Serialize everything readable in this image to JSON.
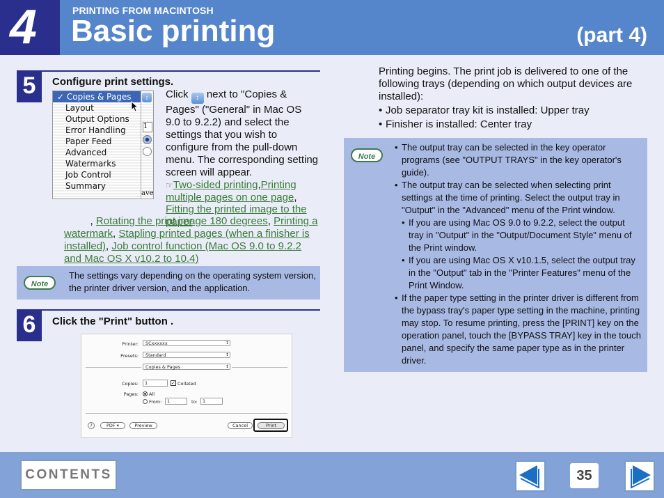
{
  "header": {
    "chapter_number": "4",
    "section_label": "PRINTING FROM MACINTOSH",
    "title": "Basic printing",
    "part": "(part 4)"
  },
  "step5": {
    "number": "5",
    "title": "Configure print settings.",
    "menu_items": [
      "✓ Copies & Pages",
      "Layout",
      "Output Options",
      "Error Handling",
      "Paper Feed",
      "Advanced",
      "Watermarks",
      "Job Control",
      "Summary"
    ],
    "menu_side_fragment": "ave",
    "menu_side_input": "1",
    "text_before_icon": "Click",
    "text_after_icon": " next to \"Copies & Pages\" (\"General\" in Mac OS 9.0 to 9.2.2) and select the settings that you wish to configure from the pull-down menu. The corresponding setting screen will appear.",
    "reference_icon": "☞",
    "links": [
      "Two-sided printing",
      "Printing multiple pages on one page",
      "Fitting the printed image to the paper",
      "Rotating the print image 180 degrees",
      "Printing a watermark",
      "Stapling printed pages (when a finisher is installed)",
      "Job control function (Mac OS 9.0 to 9.2.2 and Mac OS X v10.2 to 10.4)"
    ],
    "note_badge": "Note",
    "note_text": "The settings vary depending on the operating system version, the printer driver version, and the application."
  },
  "step6": {
    "number": "6",
    "title": "Click the \"Print\" button .",
    "dialog": {
      "printer_label": "Printer:",
      "printer_value": "SCxxxxxx",
      "presets_label": "Presets:",
      "presets_value": "Standard",
      "panel_value": "Copies & Pages",
      "copies_label": "Copies:",
      "copies_value": "1",
      "collated_label": "Collated",
      "pages_label": "Pages:",
      "all_label": "All",
      "from_label": "From:",
      "from_value": "1",
      "to_label": "to:",
      "to_value": "1",
      "help_label": "?",
      "pdf_label": "PDF ▾",
      "preview_label": "Preview",
      "cancel_label": "Cancel",
      "print_label": "Print"
    }
  },
  "right": {
    "intro": "Printing begins. The print job is delivered to one of the following trays (depending on which output devices are installed):",
    "trays": [
      "Job separator tray kit is installed: Upper tray",
      "Finisher is installed: Center tray"
    ],
    "note_badge": "Note",
    "notes": [
      "The output tray can be selected in the key operator programs (see \"OUTPUT TRAYS\" in the key operator's guide).",
      "The output tray can be selected when selecting print settings at the time of printing. Select the output tray in \"Output\" in the \"Advanced\" menu of the Print window.",
      "If the paper type setting in the printer driver is different from the bypass tray's paper type setting in the machine, printing may stop. To resume printing, press the [PRINT] key on the operation panel, touch the [BYPASS TRAY] key in the touch panel, and specify the same paper type as in the printer driver."
    ],
    "subnotes": [
      "If you are using Mac OS 9.0 to 9.2.2, select the output tray in \"Output\" in the \"Output/Document Style\" menu of the Print window.",
      "If you are using Mac OS X v10.1.5, select the output tray in the \"Output\" tab in the \"Printer Features\" menu of the Print Window."
    ]
  },
  "footer": {
    "contents_label": "CONTENTS",
    "page_number": "35"
  },
  "colors": {
    "header_blue": "#5585cb",
    "chapter_navy": "#2a2f8e",
    "note_bg": "#a8b9e4",
    "link_green": "#3a7a3a",
    "footer_blue": "#82a2d8",
    "arrow_blue": "#1a6fc4"
  }
}
